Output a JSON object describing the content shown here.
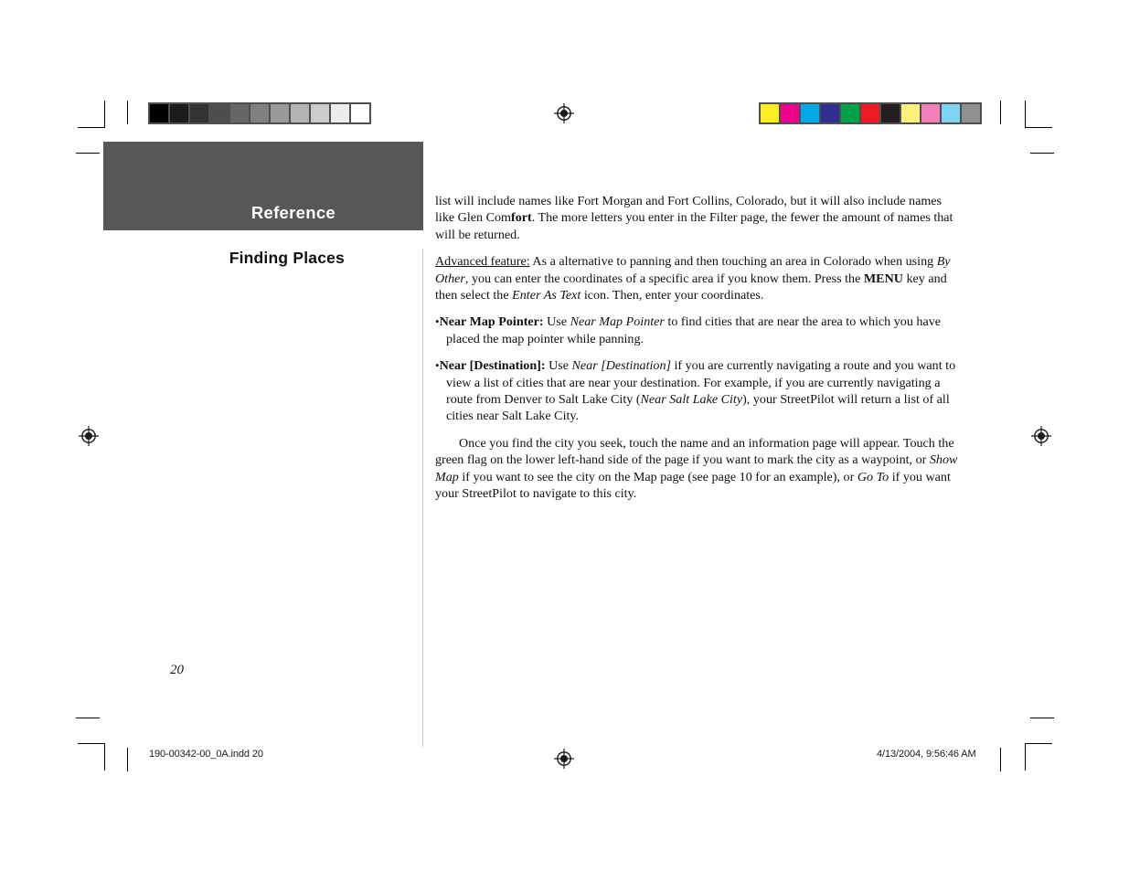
{
  "page": {
    "band_label": "Reference",
    "section_title": "Finding Places",
    "page_number": "20"
  },
  "content": {
    "para_continued": {
      "part1": "list will include names like Fort Morgan and Fort Collins, Colorado, but it will also include names like Glen Com",
      "bold": "fort",
      "part2": ". The more letters you enter in the Filter page, the fewer the amount of names that will be returned."
    },
    "advanced": {
      "label": "Advanced feature:",
      "t1": " As a alternative to panning and then touching an area in Colorado when using ",
      "i1": "By Other",
      "t2": ", you can enter the coordinates of a specific area if you know them. Press the ",
      "b1": "MENU",
      "t3": " key and then select the ",
      "i2": "Enter As Text",
      "t4": " icon. Then, enter your coordinates."
    },
    "bullets": [
      {
        "bullet": "•",
        "term": "Near Map Pointer:",
        "t1": " Use ",
        "i1": "Near Map Pointer",
        "t2": " to find cities that are near the area to which you have placed the map pointer while panning."
      },
      {
        "bullet": "•",
        "term": "Near [Destination]:",
        "t1": " Use ",
        "i1": "Near [Destination]",
        "t2": " if you are currently navigating a route and you want to view a list of cities that are near your destination. For example, if you are currently navigating a route from Denver to Salt Lake City (",
        "i2": "Near Salt Lake City",
        "t3": "), your StreetPilot will return a list of all cities near Salt Lake City."
      }
    ],
    "closing": {
      "t1": "Once you find the city you seek, touch the name and an information page will appear. Touch the green flag on the lower left-hand side of the page if you want to mark the city as a waypoint, or ",
      "i1": "Show Map",
      "t2": " if you want to see the city on the Map page (see page 10 for an example), or ",
      "i2": "Go To",
      "t3": " if you want your StreetPilot to navigate to this city."
    }
  },
  "footer": {
    "file_name": "190-00342-00_0A.indd   20",
    "timestamp": "4/13/2004, 9:56:46 AM"
  },
  "calibration": {
    "grayscale_label": "grayscale-calibration-strip",
    "grayscale_swatches": [
      "#000000",
      "#1c1c1c",
      "#333333",
      "#4d4d4d",
      "#666666",
      "#808080",
      "#999999",
      "#b3b3b3",
      "#cccccc",
      "#ececec",
      "#ffffff"
    ],
    "color_label": "color-calibration-strip",
    "color_swatches": [
      "#fcee21",
      "#ec008c",
      "#00a8e8",
      "#2e3192",
      "#00a14b",
      "#ed1c24",
      "#231f20",
      "#fcf07e",
      "#f47fbd",
      "#7fd4f4",
      "#8f8f8f"
    ]
  },
  "registration": {
    "icon_name": "registration-target-icon",
    "positions": [
      "top-center",
      "left-middle",
      "right-middle",
      "bottom-center"
    ]
  },
  "colors": {
    "band": "#585757",
    "divider": "#c9c9c9",
    "text": "#111111"
  }
}
